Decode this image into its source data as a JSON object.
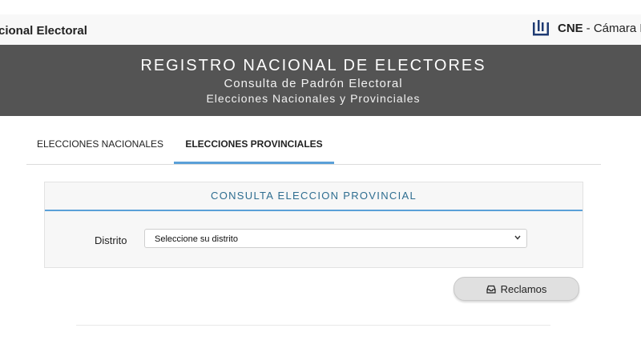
{
  "topbar": {
    "left_title": "cional Electoral",
    "brand": "CNE",
    "brand_rest": "- Cámara N",
    "logo_icon": "cne-logo-icon"
  },
  "banner": {
    "title": "REGISTRO NACIONAL DE ELECTORES",
    "subtitle": "Consulta de Padrón Electoral",
    "subtitle2": "Elecciones Nacionales y Provinciales",
    "background": "#545454"
  },
  "tabs": [
    {
      "label": "ELECCIONES NACIONALES",
      "active": false
    },
    {
      "label": "ELECCIONES PROVINCIALES",
      "active": true
    }
  ],
  "panel": {
    "title": "CONSULTA ELECCION PROVINCIAL",
    "distrito_label": "Distrito",
    "distrito_value": "Seleccione su distrito",
    "accent": "#5aa0d8"
  },
  "reclamos": {
    "label": "Reclamos",
    "icon": "inbox-icon"
  }
}
